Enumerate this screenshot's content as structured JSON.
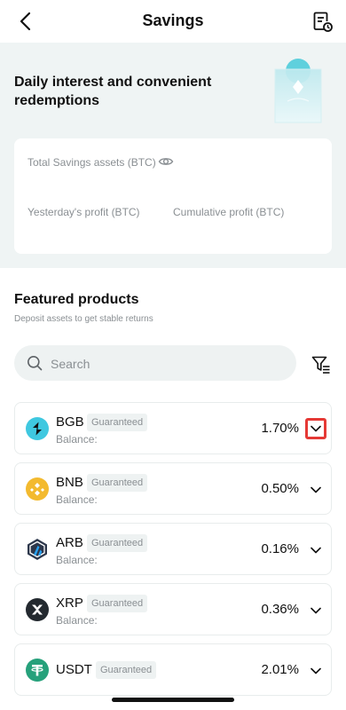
{
  "header": {
    "title": "Savings",
    "back_icon": "chevron-left-icon",
    "records_icon": "document-clock-icon"
  },
  "hero": {
    "title": "Daily interest and convenient redemptions",
    "art": "savings-bag-illustration"
  },
  "assets": {
    "total_label": "Total Savings assets (BTC)",
    "eye_icon": "eye-icon",
    "yesterday_label": "Yesterday's profit (BTC)",
    "cumulative_label": "Cumulative profit (BTC)"
  },
  "featured": {
    "title": "Featured products",
    "subtitle": "Deposit assets to get stable returns"
  },
  "search": {
    "placeholder": "Search",
    "filter_icon": "filter-icon"
  },
  "products": [
    {
      "symbol": "BGB",
      "badge": "Guaranteed",
      "balance_label": "Balance:",
      "rate": "1.70%",
      "icon_color": "#3fc8e0"
    },
    {
      "symbol": "BNB",
      "badge": "Guaranteed",
      "balance_label": "Balance:",
      "rate": "0.50%",
      "icon_color": "#f3ba2f"
    },
    {
      "symbol": "ARB",
      "badge": "Guaranteed",
      "balance_label": "Balance:",
      "rate": "0.16%",
      "icon_color": "#2d374b"
    },
    {
      "symbol": "XRP",
      "badge": "Guaranteed",
      "balance_label": "Balance:",
      "rate": "0.36%",
      "icon_color": "#23292f"
    },
    {
      "symbol": "USDT",
      "badge": "Guaranteed",
      "rate": "2.01%",
      "icon_color": "#26a17b"
    }
  ],
  "colors": {
    "hero_bg": "#eff4f4",
    "highlight": "#e53935",
    "muted_text": "#8a8f93"
  }
}
